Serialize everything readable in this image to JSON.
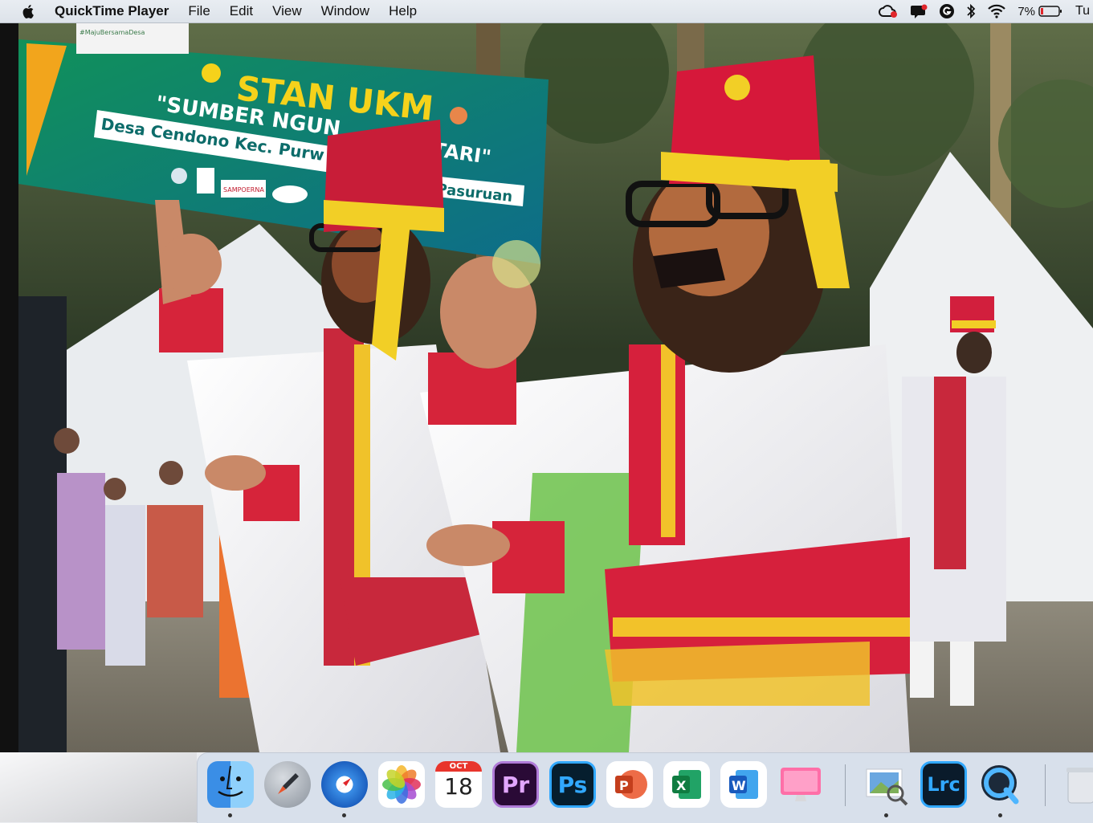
{
  "menubar": {
    "app_name": "QuickTime Player",
    "menus": [
      "File",
      "Edit",
      "View",
      "Window",
      "Help"
    ],
    "status": {
      "battery_percent": "7%",
      "clock_partial": "Tu",
      "icons": [
        "creative-cloud-icon",
        "notification-icon",
        "grammarly-icon",
        "bluetooth-icon",
        "wifi-icon",
        "battery-icon"
      ]
    }
  },
  "video": {
    "banner_line1": "STAN UKM",
    "banner_line2": "\"SUMBER NGUN",
    "banner_line2b": "TARI\"",
    "banner_line3": "Desa Cendono Kec. Purw",
    "banner_line3b": "Pasuruan",
    "banner_tag": "#MajuBersamaDesa",
    "banner_logo": "SAMPOERNA"
  },
  "dock": {
    "calendar": {
      "month": "OCT",
      "day": "18"
    },
    "items": [
      {
        "name": "Finder"
      },
      {
        "name": "Launchpad"
      },
      {
        "name": "Safari"
      },
      {
        "name": "Photos"
      },
      {
        "name": "Calendar"
      },
      {
        "name": "Adobe Premiere Pro",
        "label": "Pr"
      },
      {
        "name": "Adobe Photoshop",
        "label": "Ps"
      },
      {
        "name": "Microsoft PowerPoint",
        "label": "P"
      },
      {
        "name": "Microsoft Excel",
        "label": "X"
      },
      {
        "name": "Microsoft Word",
        "label": "W"
      },
      {
        "name": "CleanMyMac"
      },
      {
        "name": "Preview"
      },
      {
        "name": "Adobe Lightroom Classic",
        "label": "Lrc"
      },
      {
        "name": "QuickTime Player"
      },
      {
        "name": "Trash"
      }
    ]
  }
}
